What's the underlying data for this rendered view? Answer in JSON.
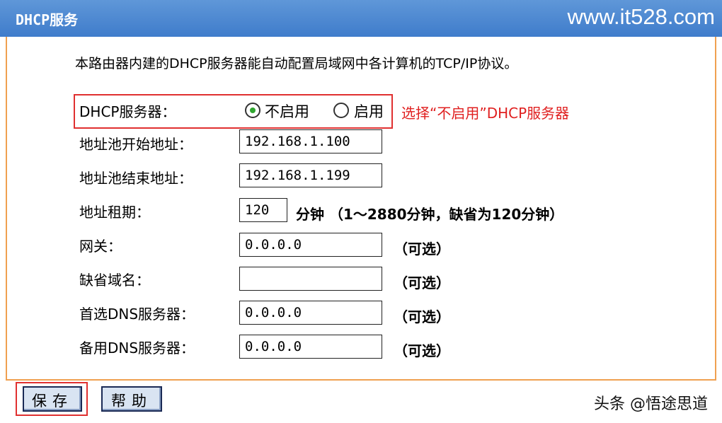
{
  "window": {
    "title": "DHCP服务",
    "watermark": "www.it528.com"
  },
  "intro": "本路由器内建的DHCP服务器能自动配置局域网中各计算机的TCP/IP协议。",
  "dhcp_server": {
    "label": "DHCP服务器：",
    "options": [
      "不启用",
      "启用"
    ],
    "selected": "不启用"
  },
  "annotation": "选择“不启用”DHCP服务器",
  "fields": {
    "pool_start": {
      "label": "地址池开始地址：",
      "value": "192.168.1.100"
    },
    "pool_end": {
      "label": "地址池结束地址：",
      "value": "192.168.1.199"
    },
    "lease": {
      "label": "地址租期：",
      "value": "120",
      "unit": "分钟 （1～2880分钟，缺省为120分钟）"
    },
    "gateway": {
      "label": "网关：",
      "value": "0.0.0.0",
      "hint": "（可选）"
    },
    "domain": {
      "label": "缺省域名：",
      "value": "",
      "hint": "（可选）"
    },
    "dns_primary": {
      "label": "首选DNS服务器：",
      "value": "0.0.0.0",
      "hint": "（可选）"
    },
    "dns_secondary": {
      "label": "备用DNS服务器：",
      "value": "0.0.0.0",
      "hint": "（可选）"
    }
  },
  "buttons": {
    "save": "保存",
    "help": "帮助"
  },
  "footer_watermark": "头条 @悟途思道",
  "colors": {
    "title_bar": "#4a86d0",
    "panel_border": "#f0a050",
    "highlight": "#e03030",
    "radio_selected": "#2fa62f"
  }
}
